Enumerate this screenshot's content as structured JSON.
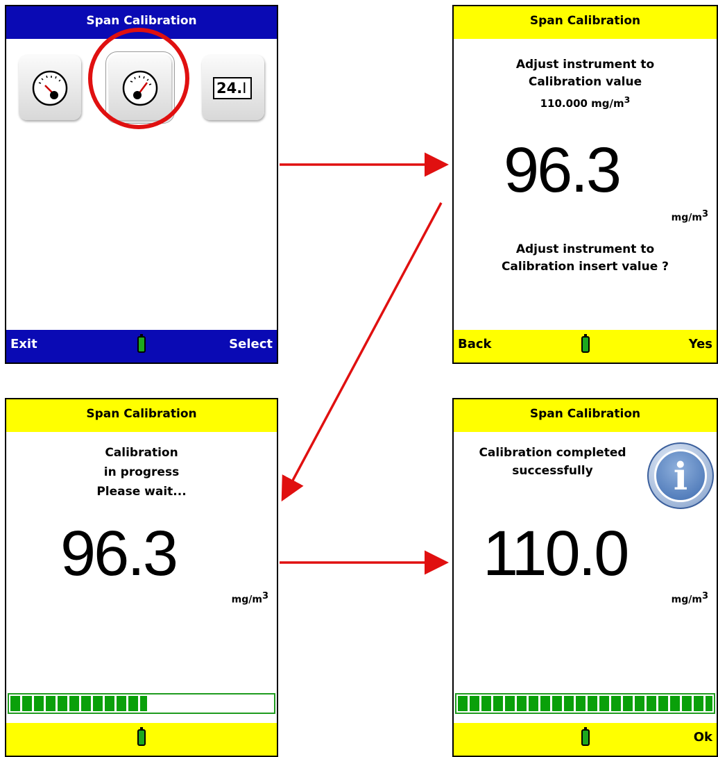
{
  "screens": {
    "menu": {
      "title": "Span Calibration",
      "numeric_icon_text": "24.",
      "footer_left": "Exit",
      "footer_right": "Select"
    },
    "adjust": {
      "title": "Span Calibration",
      "line1": "Adjust instrument to",
      "line2": "Calibration value",
      "line3": "110.000 mg/m",
      "line3_sup": "3",
      "reading": "96.3",
      "unit": "mg/m",
      "unit_sup": "3",
      "question1": "Adjust instrument to",
      "question2": "Calibration insert value ?",
      "footer_left": "Back",
      "footer_right": "Yes"
    },
    "progress": {
      "title": "Span Calibration",
      "line1": "Calibration",
      "line2": "in progress",
      "line3": "Please wait...",
      "reading": "96.3",
      "unit": "mg/m",
      "unit_sup": "3",
      "progress_fraction": 0.52
    },
    "complete": {
      "title": "Span Calibration",
      "line1": "Calibration completed",
      "line2": "successfully",
      "reading": "110.0",
      "unit": "mg/m",
      "unit_sup": "3",
      "progress_fraction": 1.0,
      "footer_right": "Ok"
    }
  },
  "colors": {
    "blue_bar": "#0a0ab4",
    "yellow_bar": "#ffff00",
    "arrow": "#e01010",
    "progress_green": "#0aa00a"
  },
  "icons": [
    "gauge-low-icon",
    "gauge-high-icon",
    "numeric-entry-icon",
    "battery-icon",
    "info-icon"
  ]
}
